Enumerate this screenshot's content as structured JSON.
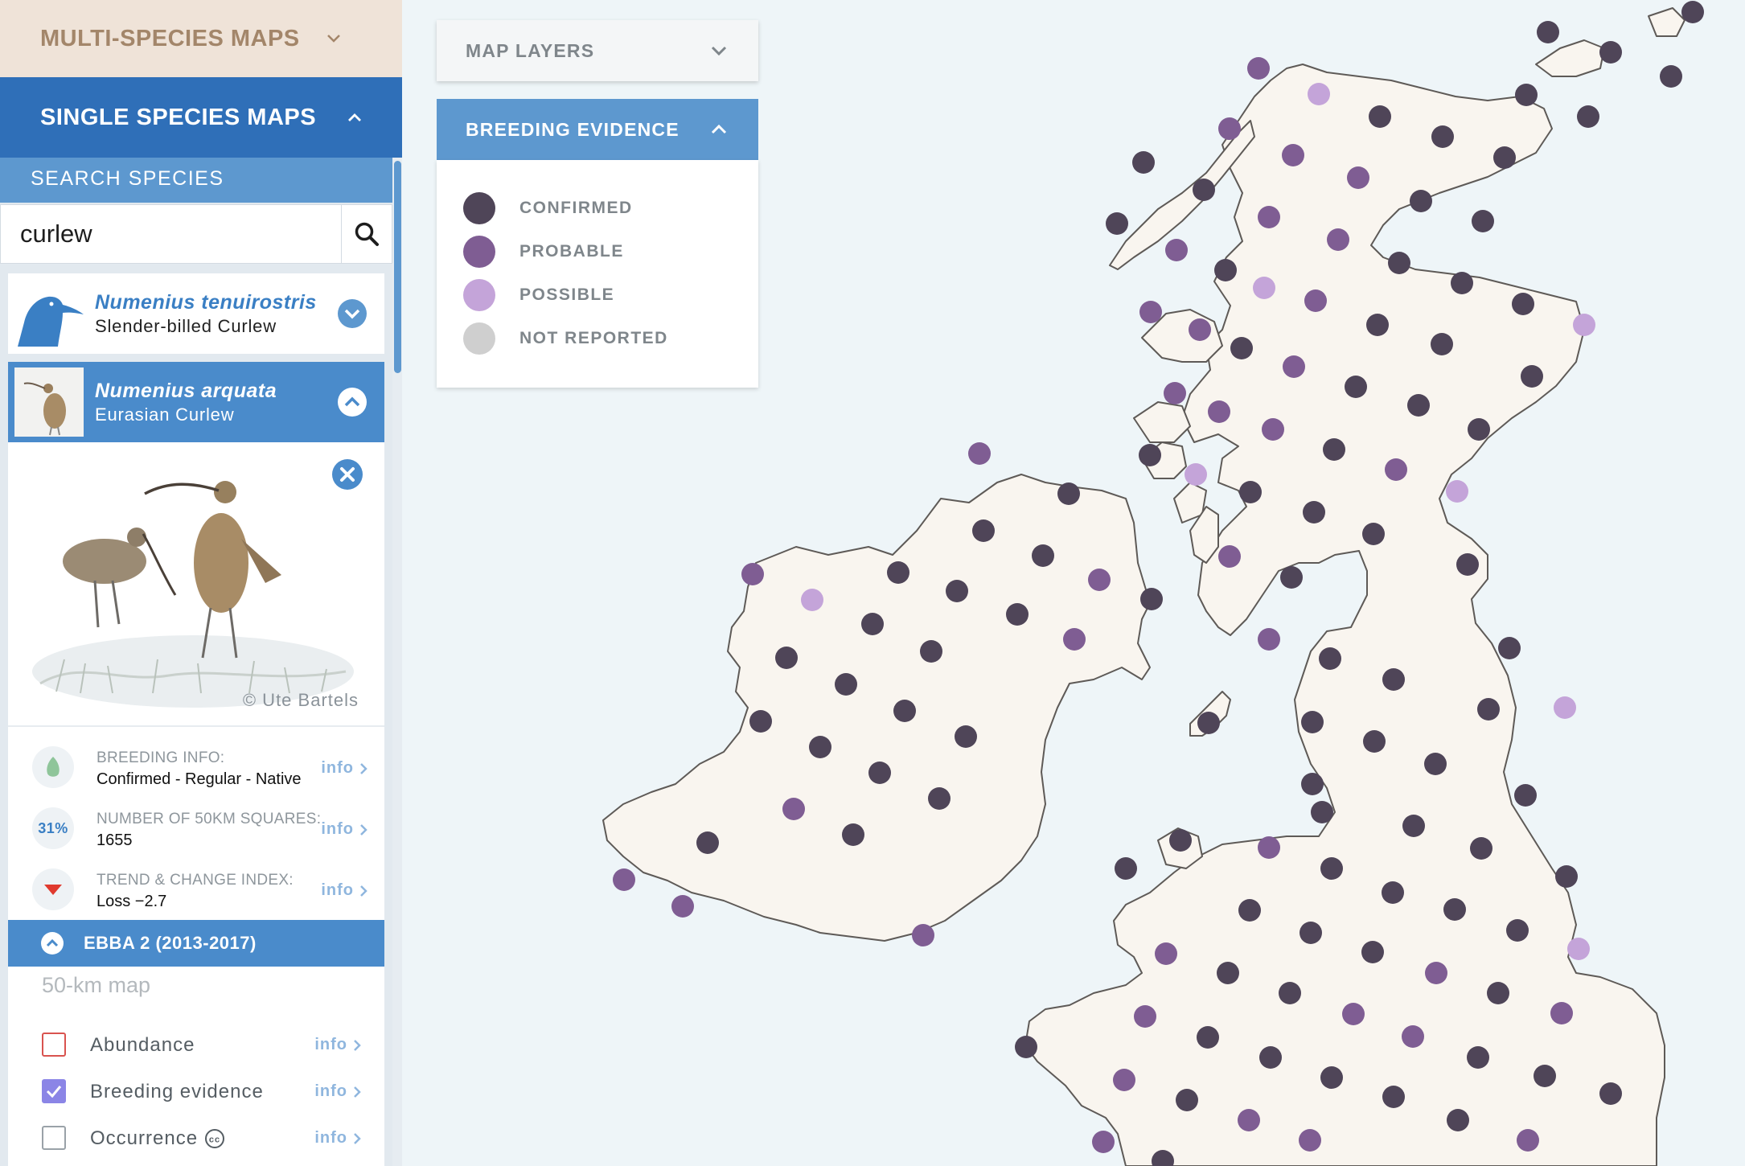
{
  "sidebar": {
    "multi_species_title": "MULTI-SPECIES MAPS",
    "single_species_title": "SINGLE SPECIES MAPS",
    "search_label": "SEARCH SPECIES",
    "search_value": "curlew",
    "results": [
      {
        "scientific": "Numenius tenuirostris",
        "common": "Slender-billed Curlew"
      },
      {
        "scientific": "Numenius arquata",
        "common": "Eurasian Curlew"
      }
    ],
    "detail": {
      "credit": "© Ute Bartels",
      "breeding_info": {
        "label": "BREEDING INFO:",
        "value": "Confirmed - Regular - Native",
        "link": "info"
      },
      "squares": {
        "label": "NUMBER OF 50KM SQUARES:",
        "value": "1655",
        "percent": "31%",
        "link": "info"
      },
      "trend": {
        "label": "TREND & CHANGE INDEX:",
        "value": "Loss −2.7",
        "link": "info"
      },
      "ebba_title": "EBBA 2 (2013-2017)",
      "map_scale": "50-km map",
      "options": [
        {
          "label": "Abundance",
          "checked": false,
          "link": "info"
        },
        {
          "label": "Breeding evidence",
          "checked": true,
          "link": "info"
        },
        {
          "label": "Occurrence",
          "checked": false,
          "link": "info"
        }
      ]
    }
  },
  "layers": {
    "map_layers_title": "MAP LAYERS",
    "breeding_evidence_title": "BREEDING EVIDENCE",
    "legend": [
      {
        "label": "CONFIRMED",
        "color": "#4f4558"
      },
      {
        "label": "PROBABLE",
        "color": "#7f5d93"
      },
      {
        "label": "POSSIBLE",
        "color": "#c4a4d9"
      },
      {
        "label": "NOT REPORTED",
        "color": "#cfcfcf"
      }
    ]
  },
  "map": {
    "land_color": "#f9f5ef",
    "coast_color": "#5e5a57",
    "water_color": "#eef5f8"
  }
}
